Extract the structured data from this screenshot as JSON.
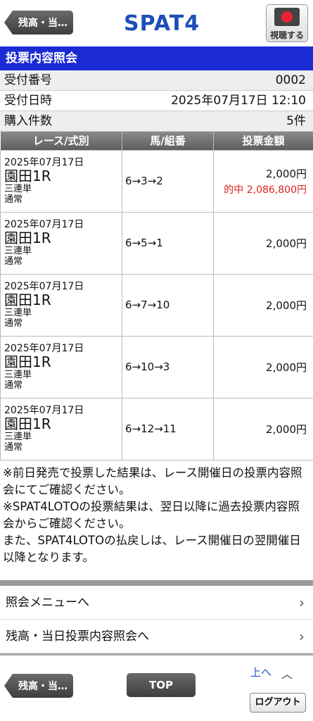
{
  "header": {
    "back_label": "残高・当…",
    "logo": "SPAT4",
    "watch_label": "視聴する"
  },
  "section_title": "投票内容照会",
  "info": {
    "receipt_label": "受付番号",
    "receipt_value": "0002",
    "datetime_label": "受付日時",
    "datetime_value": "2025年07月17日 12:10",
    "count_label": "購入件数",
    "count_value": "5件"
  },
  "table": {
    "headers": [
      "レース/式別",
      "馬/組番",
      "投票金額"
    ],
    "rows": [
      {
        "date": "2025年07月17日",
        "race": "園田1R",
        "kind": "三連単",
        "mode": "通常",
        "combo": "6→3→2",
        "amount": "2,000円",
        "hit": "的中 2,086,800円"
      },
      {
        "date": "2025年07月17日",
        "race": "園田1R",
        "kind": "三連単",
        "mode": "通常",
        "combo": "6→5→1",
        "amount": "2,000円",
        "hit": ""
      },
      {
        "date": "2025年07月17日",
        "race": "園田1R",
        "kind": "三連単",
        "mode": "通常",
        "combo": "6→7→10",
        "amount": "2,000円",
        "hit": ""
      },
      {
        "date": "2025年07月17日",
        "race": "園田1R",
        "kind": "三連単",
        "mode": "通常",
        "combo": "6→10→3",
        "amount": "2,000円",
        "hit": ""
      },
      {
        "date": "2025年07月17日",
        "race": "園田1R",
        "kind": "三連単",
        "mode": "通常",
        "combo": "6→12→11",
        "amount": "2,000円",
        "hit": ""
      }
    ]
  },
  "notes": [
    "※前日発売で投票した結果は、レース開催日の投票内容照会にてご確認ください。",
    "※SPAT4LOTOの投票結果は、翌日以降に過去投票内容照会からご確認ください。",
    "また、SPAT4LOTOの払戻しは、レース開催日の翌開催日以降となります。"
  ],
  "menu": {
    "item1": "照会メニューへ",
    "item2": "残高・当日投票内容照会へ"
  },
  "footer": {
    "back_label": "残高・当…",
    "top_label": "TOP",
    "up_label": "上へ",
    "logout_label": "ログアウト"
  },
  "colors": {
    "section_bg": "#1b2bd3",
    "logo": "#1d4fb8",
    "hit": "#e02020"
  }
}
